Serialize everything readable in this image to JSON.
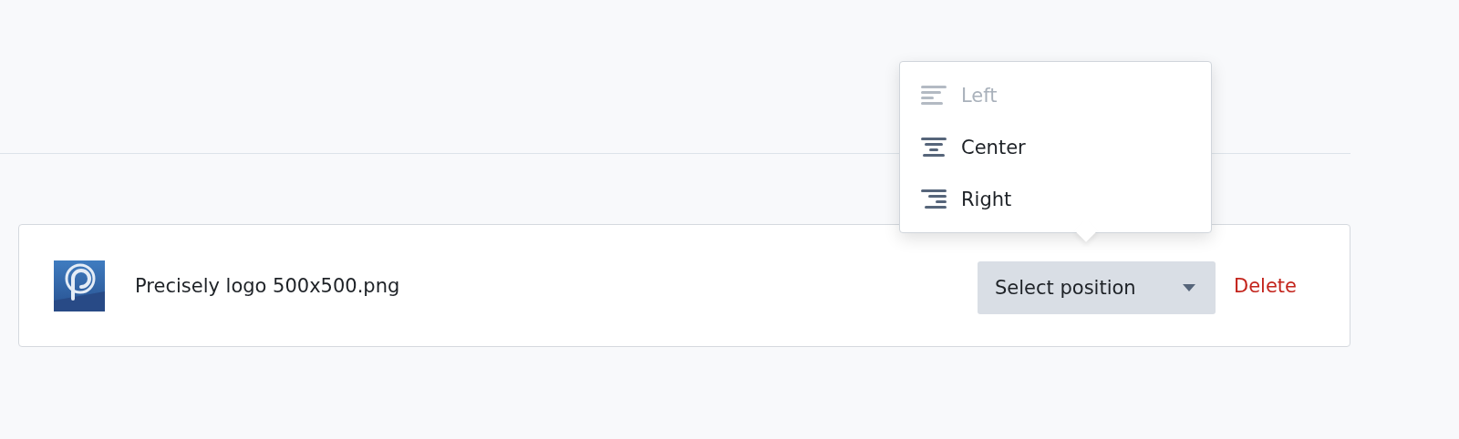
{
  "menu": {
    "items": [
      {
        "label": "Left",
        "kind": "left",
        "disabled": true
      },
      {
        "label": "Center",
        "kind": "center",
        "disabled": false
      },
      {
        "label": "Right",
        "kind": "right",
        "disabled": false
      }
    ]
  },
  "file": {
    "name": "Precisely logo 500x500.png",
    "position_button": "Select position",
    "delete_link": "Delete"
  }
}
